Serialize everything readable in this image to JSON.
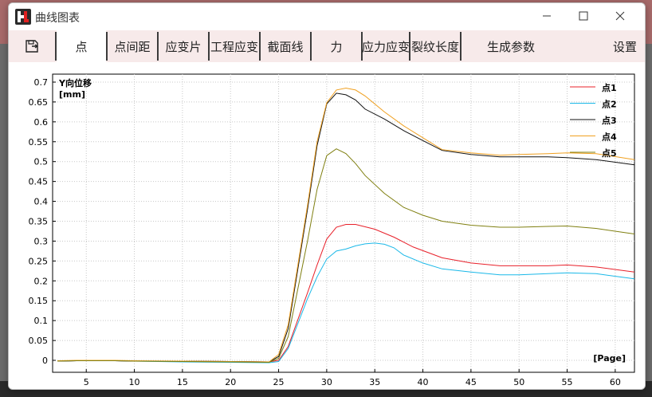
{
  "window": {
    "title": "曲线图表"
  },
  "toolbar": {
    "save_icon": "save-icon",
    "tabs": [
      "点",
      "点间距",
      "应变片",
      "工程应变",
      "截面线",
      "力",
      "应力应变",
      "裂纹长度",
      "生成参数"
    ],
    "settings": "设置",
    "selected": "点"
  },
  "colors": {
    "point1": "#e8202a",
    "point2": "#1ab8e8",
    "point3": "#111111",
    "point4": "#f0a020",
    "point5": "#7f7f10"
  },
  "chart_data": {
    "type": "line",
    "ylabel": "Y向位移\n[mm]",
    "ylabel_line1": "Y向位移",
    "ylabel_line2": "[mm]",
    "xlabel": "[Page]",
    "xlim": [
      1.5,
      62
    ],
    "ylim": [
      -0.03,
      0.72
    ],
    "xticks": [
      5,
      10,
      15,
      20,
      25,
      30,
      35,
      40,
      45,
      50,
      55,
      60
    ],
    "yticks": [
      0,
      0.05,
      0.1,
      0.15,
      0.2,
      0.25,
      0.3,
      0.35,
      0.4,
      0.45,
      0.5,
      0.55,
      0.6,
      0.65,
      0.7
    ],
    "ytick_labels": [
      "0",
      "0.05",
      "0.1",
      "0.15",
      "0.2",
      "0.25",
      "0.3",
      "0.35",
      "0.4",
      "0.45",
      "0.5",
      "0.55",
      "0.6",
      "0.65",
      "0.7"
    ],
    "grid": true,
    "legend_position": "top-right",
    "series": [
      {
        "name": "点1",
        "color": "#e8202a",
        "x": [
          2,
          4,
          8,
          10,
          15,
          20,
          24,
          25,
          26,
          28,
          29,
          30,
          31,
          32,
          33,
          35,
          37,
          39,
          42,
          45,
          48,
          50,
          53,
          55,
          58,
          62
        ],
        "y": [
          -0.002,
          -0.001,
          -0.001,
          -0.002,
          -0.002,
          -0.003,
          -0.004,
          0.0,
          0.035,
          0.17,
          0.24,
          0.305,
          0.335,
          0.342,
          0.342,
          0.33,
          0.31,
          0.285,
          0.258,
          0.245,
          0.238,
          0.238,
          0.238,
          0.24,
          0.235,
          0.222
        ]
      },
      {
        "name": "点2",
        "color": "#1ab8e8",
        "x": [
          2,
          4,
          8,
          10,
          15,
          20,
          24,
          25,
          26,
          28,
          29,
          30,
          31,
          32,
          33,
          34,
          35,
          36,
          37,
          38,
          40,
          42,
          45,
          48,
          50,
          53,
          55,
          58,
          62
        ],
        "y": [
          -0.002,
          -0.001,
          -0.001,
          -0.002,
          -0.004,
          -0.005,
          -0.006,
          -0.003,
          0.03,
          0.155,
          0.21,
          0.255,
          0.275,
          0.28,
          0.288,
          0.293,
          0.295,
          0.292,
          0.283,
          0.265,
          0.245,
          0.23,
          0.222,
          0.215,
          0.215,
          0.218,
          0.22,
          0.218,
          0.205
        ]
      },
      {
        "name": "点3",
        "color": "#111111",
        "x": [
          2,
          4,
          8,
          10,
          15,
          20,
          24,
          25,
          26,
          28,
          29,
          30,
          31,
          32,
          33,
          34,
          36,
          38,
          40,
          42,
          45,
          48,
          50,
          53,
          55,
          58,
          62
        ],
        "y": [
          -0.002,
          -0.001,
          -0.001,
          -0.002,
          -0.002,
          -0.003,
          -0.004,
          0.01,
          0.08,
          0.38,
          0.54,
          0.645,
          0.672,
          0.668,
          0.655,
          0.632,
          0.607,
          0.578,
          0.553,
          0.528,
          0.518,
          0.512,
          0.512,
          0.512,
          0.51,
          0.505,
          0.492
        ]
      },
      {
        "name": "点4",
        "color": "#f0a020",
        "x": [
          2,
          4,
          8,
          10,
          15,
          20,
          24,
          25,
          26,
          28,
          29,
          30,
          31,
          32,
          33,
          34,
          36,
          38,
          40,
          42,
          45,
          48,
          50,
          53,
          55,
          58,
          62
        ],
        "y": [
          -0.001,
          0.0,
          0.0,
          -0.001,
          -0.002,
          -0.003,
          -0.004,
          0.015,
          0.09,
          0.39,
          0.55,
          0.648,
          0.68,
          0.685,
          0.68,
          0.665,
          0.625,
          0.59,
          0.56,
          0.53,
          0.522,
          0.516,
          0.518,
          0.52,
          0.522,
          0.52,
          0.505
        ]
      },
      {
        "name": "点5",
        "color": "#7f7f10",
        "x": [
          2,
          4,
          8,
          10,
          15,
          20,
          24,
          25,
          26,
          28,
          29,
          30,
          31,
          32,
          33,
          34,
          36,
          38,
          40,
          42,
          45,
          48,
          50,
          53,
          55,
          58,
          62
        ],
        "y": [
          -0.002,
          -0.001,
          -0.001,
          -0.002,
          -0.003,
          -0.004,
          -0.005,
          0.005,
          0.06,
          0.3,
          0.43,
          0.515,
          0.532,
          0.52,
          0.495,
          0.465,
          0.42,
          0.385,
          0.365,
          0.35,
          0.34,
          0.335,
          0.335,
          0.337,
          0.338,
          0.332,
          0.318
        ]
      }
    ]
  }
}
